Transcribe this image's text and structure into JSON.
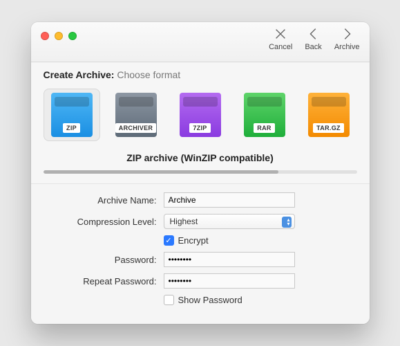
{
  "toolbar": {
    "cancel": "Cancel",
    "back": "Back",
    "archive": "Archive"
  },
  "header": {
    "title": "Create Archive:",
    "subtitle": "Choose format"
  },
  "formats": [
    {
      "id": "zip",
      "label": "ZIP",
      "selected": true
    },
    {
      "id": "arch",
      "label": "ARCHIVER",
      "selected": false
    },
    {
      "id": "7zip",
      "label": "7ZIP",
      "selected": false
    },
    {
      "id": "rar",
      "label": "RAR",
      "selected": false
    },
    {
      "id": "targz",
      "label": "TAR.GZ",
      "selected": false
    }
  ],
  "description": "ZIP archive (WinZIP compatible)",
  "progress_percent": 75,
  "form": {
    "archive_name_label": "Archive Name:",
    "archive_name_value": "Archive",
    "compression_label": "Compression Level:",
    "compression_value": "Highest",
    "encrypt_label": "Encrypt",
    "encrypt_checked": true,
    "password_label": "Password:",
    "password_value": "••••••••",
    "repeat_password_label": "Repeat Password:",
    "repeat_password_value": "••••••••",
    "show_password_label": "Show Password",
    "show_password_checked": false
  }
}
